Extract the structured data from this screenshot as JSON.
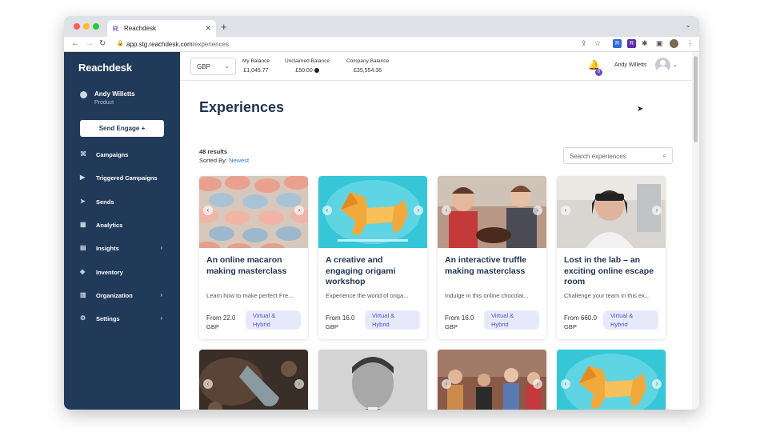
{
  "browser": {
    "tab_title": "Reachdesk",
    "url_host": "app.stg.reachdesk.com",
    "url_path": "/experiences"
  },
  "sidebar": {
    "logo": "Reachdesk",
    "user_name": "Andy Willetts",
    "user_role": "Product",
    "send_button": "Send Engage +",
    "items": [
      {
        "label": "Campaigns",
        "icon": "gift-icon",
        "glyph": "⌘",
        "chevron": false
      },
      {
        "label": "Triggered Campaigns",
        "icon": "play-circle-icon",
        "glyph": "▶",
        "chevron": false
      },
      {
        "label": "Sends",
        "icon": "paper-plane-icon",
        "glyph": "➤",
        "chevron": false
      },
      {
        "label": "Analytics",
        "icon": "chart-icon",
        "glyph": "▦",
        "chevron": false
      },
      {
        "label": "Insights",
        "icon": "insights-icon",
        "glyph": "▤",
        "chevron": true
      },
      {
        "label": "Inventory",
        "icon": "box-icon",
        "glyph": "◈",
        "chevron": false
      },
      {
        "label": "Organization",
        "icon": "building-icon",
        "glyph": "▥",
        "chevron": true
      },
      {
        "label": "Settings",
        "icon": "gears-icon",
        "glyph": "⚙",
        "chevron": true
      }
    ]
  },
  "topbar": {
    "currency": "GBP",
    "balances": [
      {
        "label": "My Balance",
        "value": "£1,045.77"
      },
      {
        "label": "Unclaimed Balance",
        "value": "£50.00"
      },
      {
        "label": "Company Balance",
        "value": "£35,554.36"
      }
    ],
    "notification_count": "0",
    "user_name": "Andy Willetts"
  },
  "main": {
    "title": "Experiences",
    "results": "48 results",
    "sorted_by_label": "Sorted By:",
    "sorted_by_value": "Newest",
    "search_placeholder": "Search experiences",
    "cards": [
      {
        "title": "An online macaron making masterclass",
        "desc": "Learn how to make perfect Fre...",
        "price_label": "From 22.0",
        "currency": "GBP",
        "tag_line1": "Virtual &",
        "tag_line2": "Hybrid",
        "image": "macarons"
      },
      {
        "title": "A creative and engaging origami workshop",
        "desc": "Experience the world of origa...",
        "price_label": "From 16.0",
        "currency": "GBP",
        "tag_line1": "Virtual &",
        "tag_line2": "Hybrid",
        "image": "origami-lion"
      },
      {
        "title": "An interactive truffle making masterclass",
        "desc": "Indulge in this online chocolat...",
        "price_label": "From 16.0",
        "currency": "GBP",
        "tag_line1": "Virtual &",
        "tag_line2": "Hybrid",
        "image": "truffle-people"
      },
      {
        "title": "Lost in the lab – an exciting online escape room",
        "desc": "Challenge your team in this ex...",
        "price_label": "From 660.0",
        "currency": "GBP",
        "tag_line1": "Virtual &",
        "tag_line2": "Hybrid",
        "image": "lab-woman"
      }
    ]
  }
}
